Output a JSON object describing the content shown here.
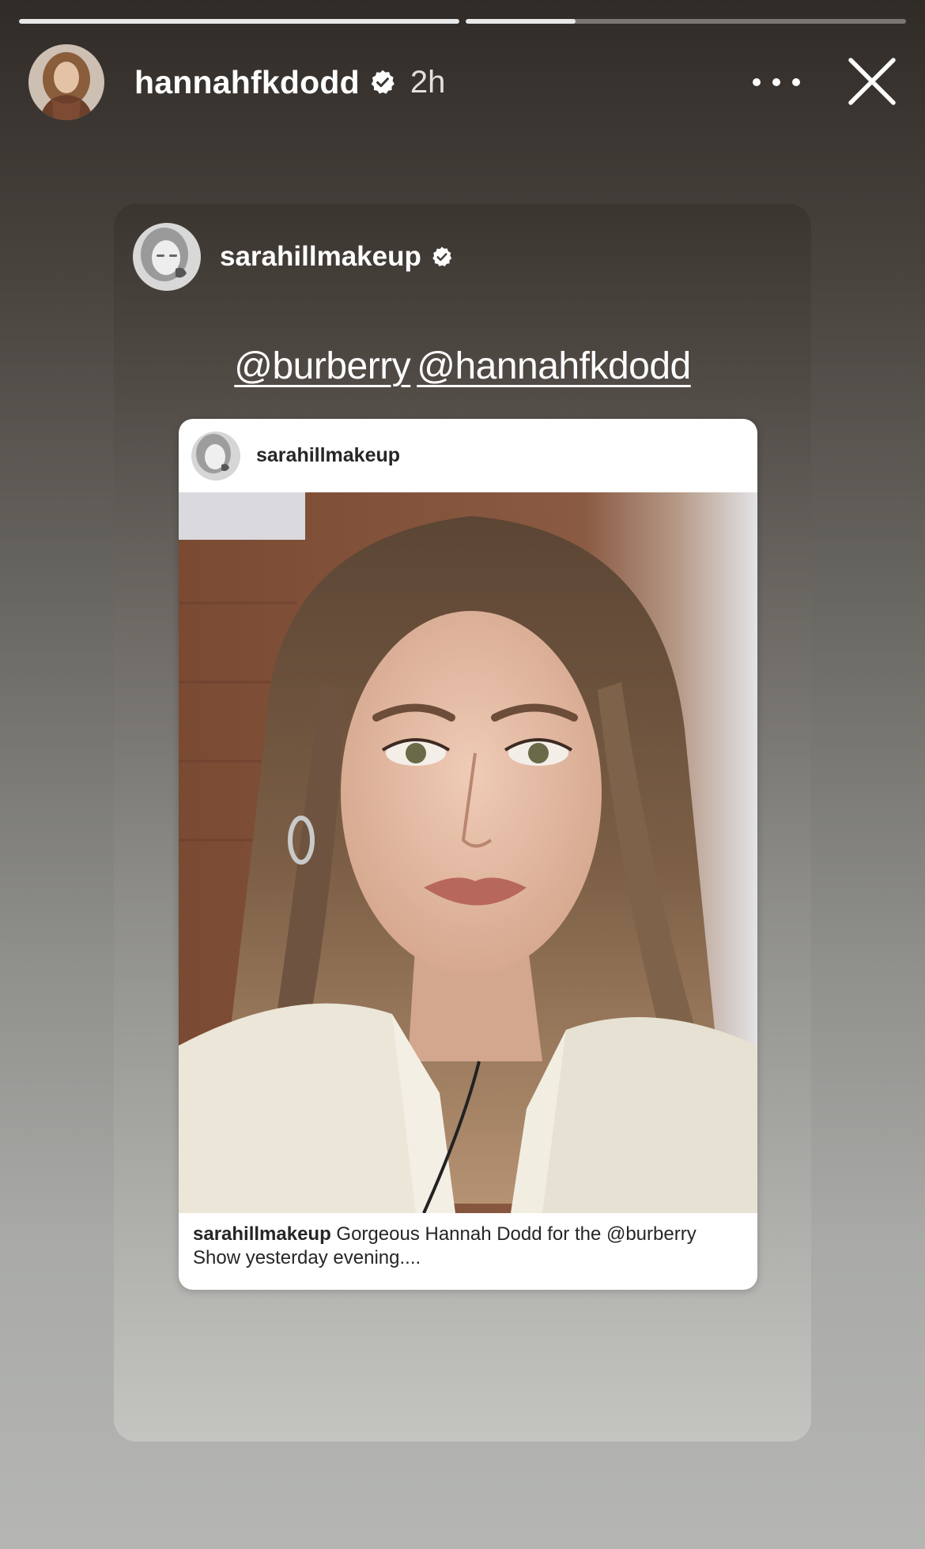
{
  "story": {
    "progress": [
      1.0,
      0.25
    ],
    "username": "hannahfkdodd",
    "time": "2h"
  },
  "shared": {
    "username": "sarahillmakeup",
    "mentions": [
      "@burberry",
      "@hannahfkdodd"
    ]
  },
  "post": {
    "username": "sarahillmakeup",
    "caption_user": "sarahillmakeup",
    "caption_text": " Gorgeous Hannah Dodd for the @burberry Show yesterday evening...."
  },
  "icons": [
    "verified-badge-icon",
    "more-options-icon",
    "close-icon"
  ]
}
